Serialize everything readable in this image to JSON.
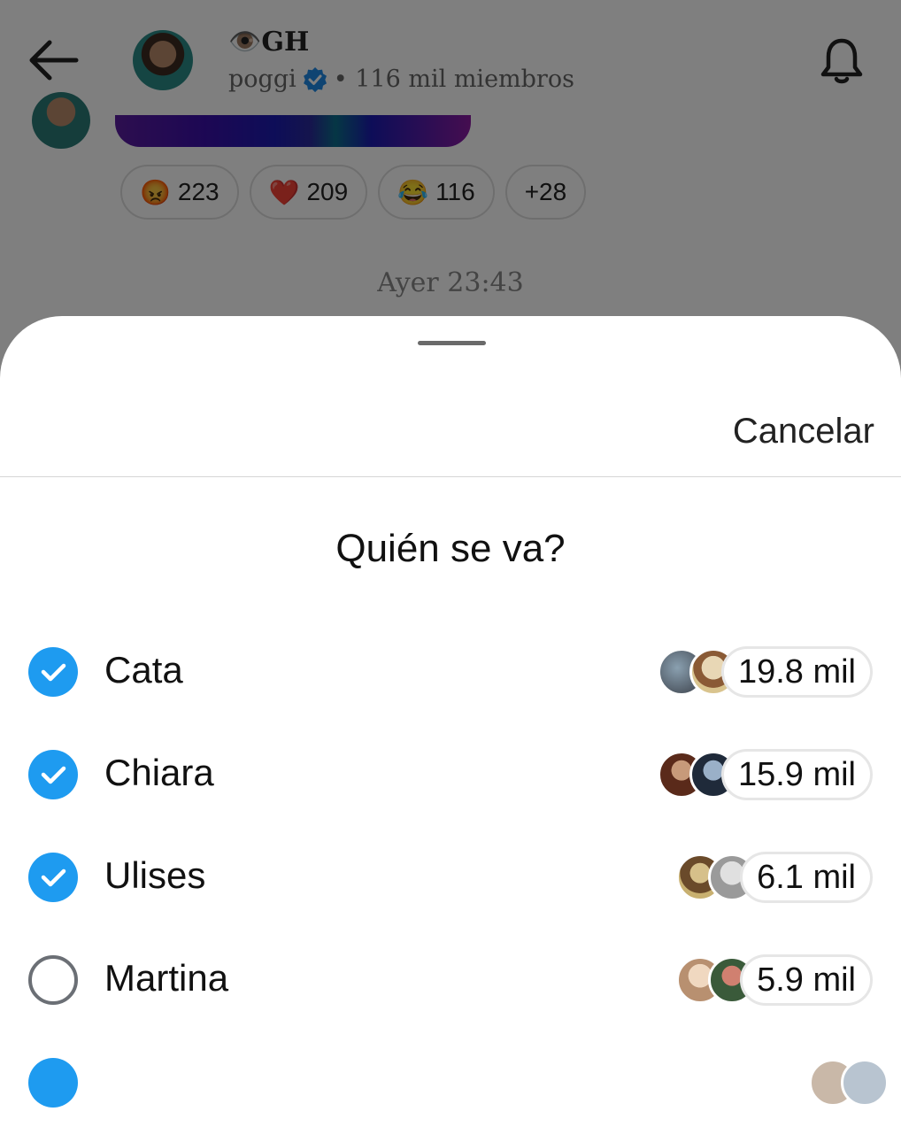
{
  "header": {
    "title": "👁️GH",
    "channel": "poggi",
    "members": "• 116 mil miembros",
    "icons": {
      "back": "arrow-left-icon",
      "bell": "bell-icon",
      "verified": "verified-badge-icon"
    }
  },
  "reactions": [
    {
      "emoji": "😡",
      "count": "223"
    },
    {
      "emoji": "❤️",
      "count": "209"
    },
    {
      "emoji": "😂",
      "count": "116"
    },
    {
      "emoji": "",
      "count": "+28"
    }
  ],
  "timestamp": "Ayer 23:43",
  "sheet": {
    "cancel_label": "Cancelar",
    "question": "Quién se va?"
  },
  "poll_options": [
    {
      "label": "Cata",
      "votes": "19.8 mil",
      "selected": true
    },
    {
      "label": "Chiara",
      "votes": "15.9 mil",
      "selected": true
    },
    {
      "label": "Ulises",
      "votes": "6.1 mil",
      "selected": true
    },
    {
      "label": "Martina",
      "votes": "5.9 mil",
      "selected": false
    }
  ],
  "colors": {
    "accent": "#1e9bf0",
    "overlay": "rgba(0,0,0,0.5)",
    "text": "#111111"
  }
}
